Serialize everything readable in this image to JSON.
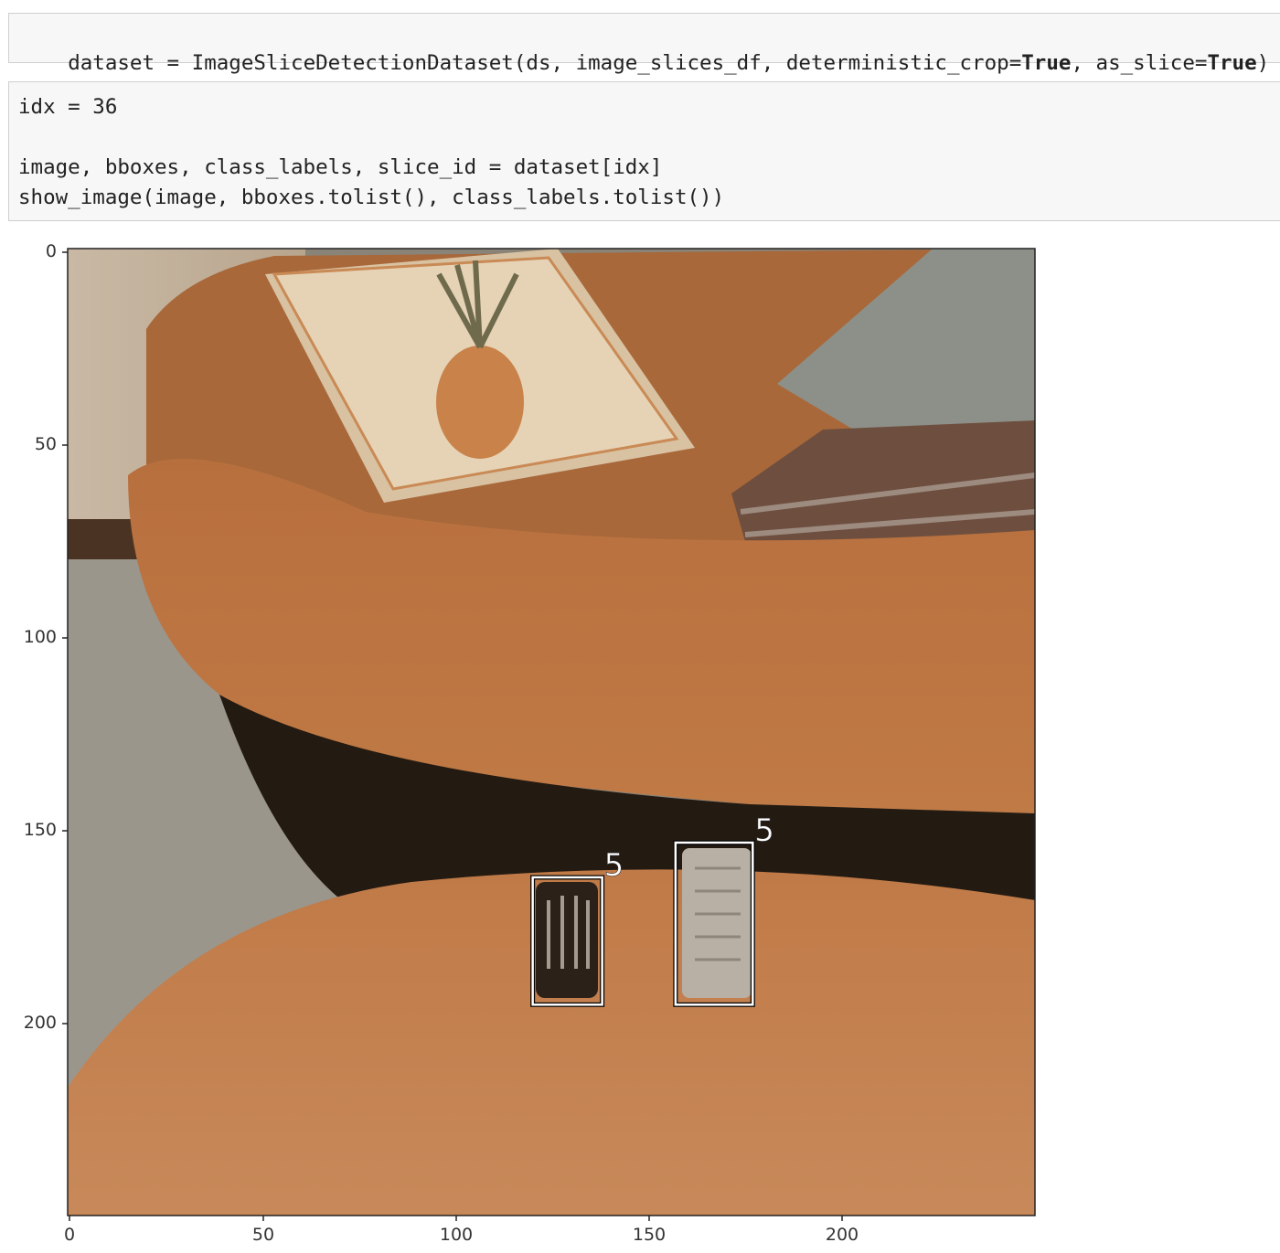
{
  "cell1": {
    "code_parts": [
      "dataset = ImageSliceDetectionDataset(ds, image_slices_df, deterministic_crop=",
      "True",
      ", as_slice=",
      "True",
      ")"
    ]
  },
  "cell2": {
    "line1": "idx = 36",
    "line3": "image, bboxes, class_labels, slice_id = dataset[idx]",
    "line4": "show_image(image, bboxes.tolist(), class_labels.tolist())"
  },
  "plot": {
    "x_ticks": [
      "0",
      "50",
      "100",
      "150",
      "200"
    ],
    "y_ticks": [
      "0",
      "50",
      "100",
      "150",
      "200"
    ],
    "image_description_icon": "image-icon",
    "boxes": [
      {
        "label": "5",
        "x_min": 120,
        "y_min": 162,
        "x_max": 138,
        "y_max": 195
      },
      {
        "label": "5",
        "x_min": 157,
        "y_min": 153,
        "x_max": 177,
        "y_max": 195
      }
    ],
    "colors": {
      "box_stroke": "#ffffff",
      "label_color": "#ffffff"
    }
  }
}
